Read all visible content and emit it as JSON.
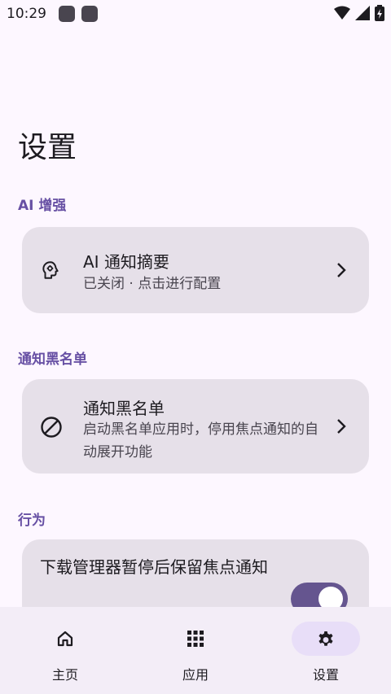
{
  "status_bar": {
    "time": "10:29"
  },
  "page": {
    "title": "设置"
  },
  "sections": {
    "ai": {
      "header": "AI 增强",
      "card": {
        "title": "AI 通知摘要",
        "subtitle": "已关闭 · 点击进行配置"
      }
    },
    "blacklist": {
      "header": "通知黑名单",
      "card": {
        "title": "通知黑名单",
        "subtitle": "启动黑名单应用时，停用焦点通知的自动展开功能"
      }
    },
    "behavior": {
      "header": "行为",
      "card": {
        "title": "下载管理器暂停后保留焦点通知",
        "toggle_on": true
      }
    }
  },
  "bottom_nav": {
    "items": [
      {
        "label": "主页",
        "icon": "home-icon",
        "active": false
      },
      {
        "label": "应用",
        "icon": "apps-grid-icon",
        "active": false
      },
      {
        "label": "设置",
        "icon": "gear-icon",
        "active": true
      }
    ]
  },
  "colors": {
    "accent": "#6750A4",
    "card_bg": "#E6E0E9",
    "toggle": "#65558F",
    "nav_active": "#E8DEF8"
  }
}
